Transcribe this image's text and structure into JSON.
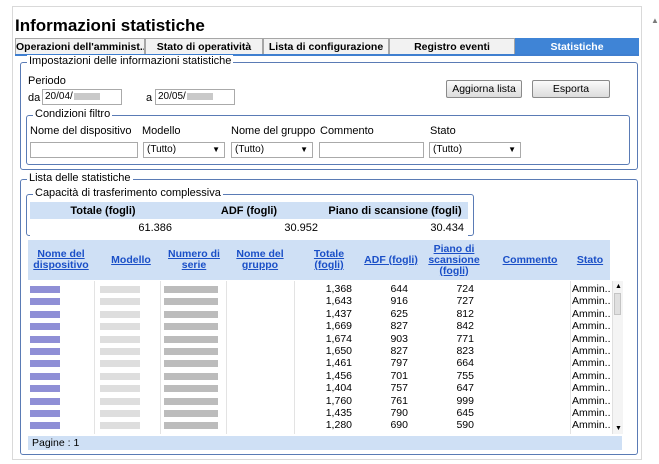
{
  "title": "Informazioni statistiche",
  "tabs": [
    {
      "label": "Operazioni dell'amminist...",
      "active": false
    },
    {
      "label": "Stato di operatività",
      "active": false
    },
    {
      "label": "Lista di configurazione",
      "active": false
    },
    {
      "label": "Registro eventi",
      "active": false
    },
    {
      "label": "Statistiche",
      "active": true
    }
  ],
  "settings": {
    "legend": "Impostazioni delle informazioni statistiche",
    "period_label": "Periodo",
    "from_label": "da",
    "from_value": "20/04/",
    "to_label": "a",
    "to_value": "20/05/",
    "update_button": "Aggiorna lista",
    "export_button": "Esporta",
    "filter": {
      "legend": "Condizioni filtro",
      "device_name_label": "Nome del dispositivo",
      "model_label": "Modello",
      "model_value": "(Tutto)",
      "group_name_label": "Nome del gruppo",
      "group_value": "(Tutto)",
      "comment_label": "Commento",
      "status_label": "Stato",
      "status_value": "(Tutto)"
    }
  },
  "stats": {
    "legend": "Lista delle statistiche",
    "capacity_legend": "Capacità di trasferimento complessiva",
    "summary_headers": [
      "Totale (fogli)",
      "ADF (fogli)",
      "Piano di scansione (fogli)"
    ],
    "summary_values": [
      "61.386",
      "30.952",
      "30.434"
    ],
    "columns": [
      "Nome del dispositivo",
      "Modello",
      "Numero di serie",
      "Nome del gruppo",
      "Totale (fogli)",
      "ADF (fogli)",
      "Piano di scansione (fogli)",
      "Commento",
      "Stato"
    ],
    "rows": [
      {
        "total": "1,368",
        "adf": "644",
        "flatbed": "724",
        "status": "Ammin..."
      },
      {
        "total": "1,643",
        "adf": "916",
        "flatbed": "727",
        "status": "Ammin..."
      },
      {
        "total": "1,437",
        "adf": "625",
        "flatbed": "812",
        "status": "Ammin..."
      },
      {
        "total": "1,669",
        "adf": "827",
        "flatbed": "842",
        "status": "Ammin..."
      },
      {
        "total": "1,674",
        "adf": "903",
        "flatbed": "771",
        "status": "Ammin..."
      },
      {
        "total": "1,650",
        "adf": "827",
        "flatbed": "823",
        "status": "Ammin..."
      },
      {
        "total": "1,461",
        "adf": "797",
        "flatbed": "664",
        "status": "Ammin..."
      },
      {
        "total": "1,456",
        "adf": "701",
        "flatbed": "755",
        "status": "Ammin..."
      },
      {
        "total": "1,404",
        "adf": "757",
        "flatbed": "647",
        "status": "Ammin..."
      },
      {
        "total": "1,760",
        "adf": "761",
        "flatbed": "999",
        "status": "Ammin..."
      },
      {
        "total": "1,435",
        "adf": "790",
        "flatbed": "645",
        "status": "Ammin..."
      },
      {
        "total": "1,280",
        "adf": "690",
        "flatbed": "590",
        "status": "Ammin..."
      }
    ],
    "pages_label": "Pagine : 1"
  },
  "icons": {
    "dropdown": "chevron-down-icon",
    "scroll_up": "scroll-up-icon",
    "scroll_down": "scroll-down-icon"
  },
  "colors": {
    "active_tab": "#3f84d6",
    "header_bg": "#cfe0f5",
    "link": "#1a4fc7"
  }
}
